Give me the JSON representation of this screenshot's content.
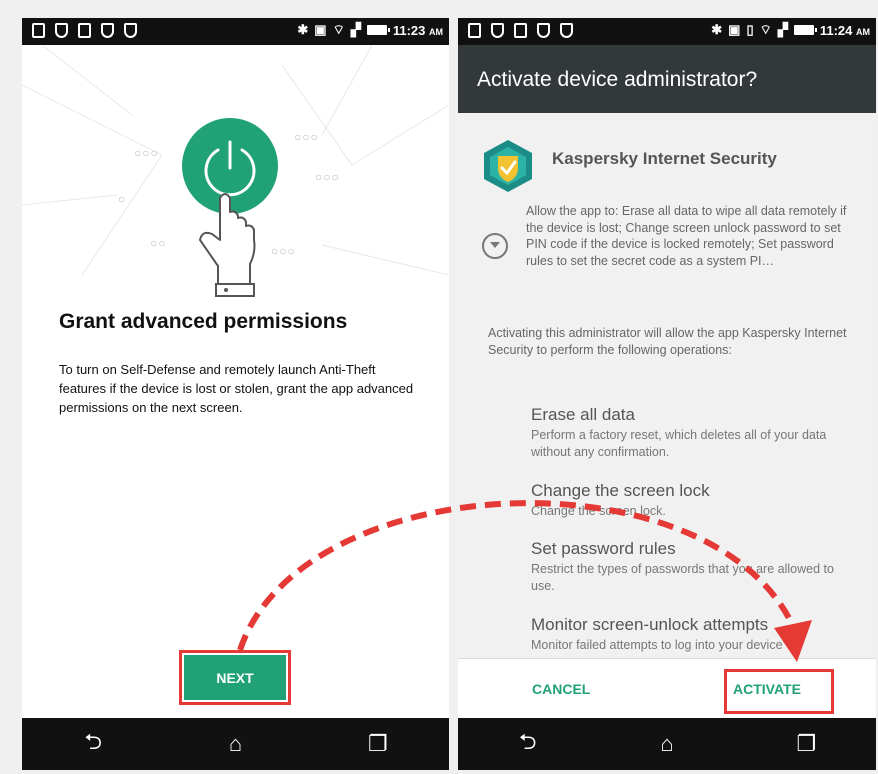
{
  "status_left": {
    "time": "11:23",
    "ampm": "AM"
  },
  "status_right": {
    "time": "11:24",
    "ampm": "AM"
  },
  "left_screen": {
    "title": "Grant advanced permissions",
    "body": "To turn on Self-Defense and remotely launch Anti-Theft features if the device is lost or stolen, grant the app advanced permissions on the next screen.",
    "next_label": "NEXT"
  },
  "right_screen": {
    "appbar_title": "Activate device administrator?",
    "app_name": "Kaspersky Internet Security",
    "allow_text": "Allow the app to: Erase all data to wipe all data remotely if the device is lost; Change screen unlock password to set PIN code if the device is locked remotely; Set password rules to set the secret code as a system PI…",
    "activating_text": "Activating this administrator will allow the app Kaspersky Internet Security to perform the following operations:",
    "operations": [
      {
        "title": "Erase all data",
        "desc": "Perform a factory reset, which deletes all of your data without any confirmation."
      },
      {
        "title": "Change the screen lock",
        "desc": "Change the screen lock."
      },
      {
        "title": "Set password rules",
        "desc": "Restrict the types of passwords that you are allowed to use."
      },
      {
        "title": "Monitor screen-unlock attempts",
        "desc": "Monitor failed attempts to log into your device"
      }
    ],
    "cancel_label": "CANCEL",
    "activate_label": "ACTIVATE"
  },
  "nav_icons": [
    "back-icon",
    "home-icon",
    "recents-icon"
  ],
  "colors": {
    "accent": "#21a276",
    "highlight": "#e53935",
    "appbar": "#33383b"
  }
}
